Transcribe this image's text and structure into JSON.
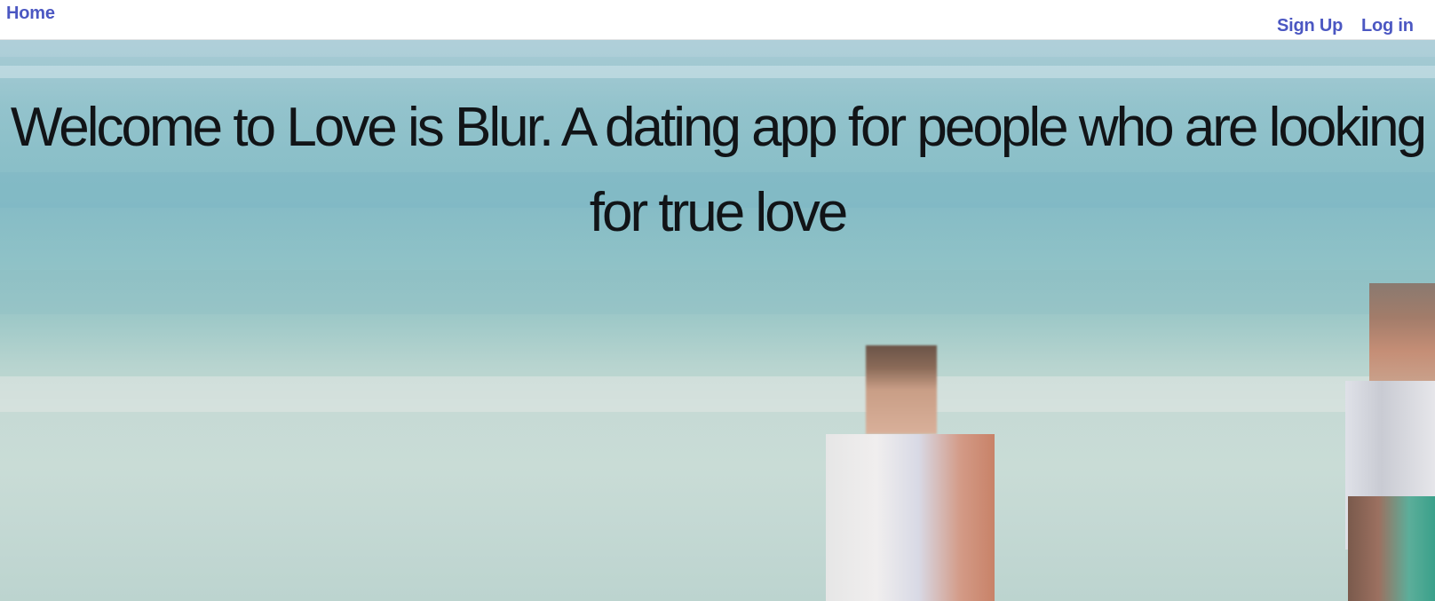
{
  "nav": {
    "home_label": "Home",
    "signup_label": "Sign Up",
    "login_label": "Log in"
  },
  "hero": {
    "headline": "Welcome to Love is Blur. A dating app for people who are looking for true love"
  },
  "colors": {
    "nav_link": "#4b57c2",
    "headline": "#111417",
    "nav_background": "#ffffff"
  }
}
